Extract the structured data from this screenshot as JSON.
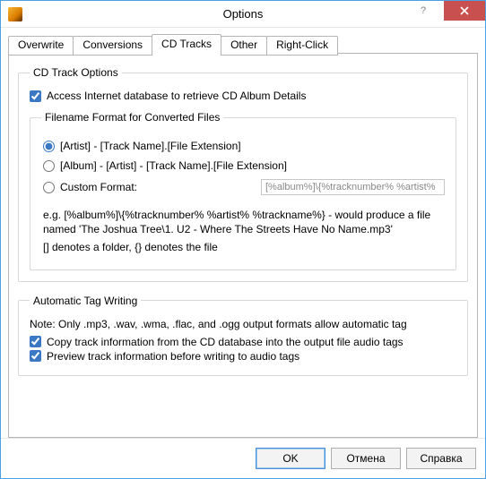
{
  "window": {
    "title": "Options"
  },
  "tabs": {
    "overwrite": "Overwrite",
    "conversions": "Conversions",
    "cdtracks": "CD Tracks",
    "other": "Other",
    "rightclick": "Right-Click"
  },
  "group_cdtrack": {
    "legend": "CD Track Options",
    "access_label": "Access Internet database to retrieve CD Album Details",
    "access_checked": true
  },
  "group_filename": {
    "legend": "Filename Format for Converted Files",
    "radio1_label": "[Artist] - [Track Name].[File Extension]",
    "radio2_label": "[Album] - [Artist] - [Track Name].[File Extension]",
    "radio3_label": "Custom Format:",
    "custom_value": "[%album%]\\{%tracknumber% %artist%",
    "eg_text": "e.g. [%album%]\\{%tracknumber% %artist% %trackname%} - would produce a file named 'The Joshua Tree\\1. U2 - Where The Streets Have No Name.mp3'",
    "eg_note": "[] denotes a folder, {} denotes the file"
  },
  "group_autotag": {
    "legend": "Automatic Tag Writing",
    "note": "Note: Only .mp3, .wav, .wma, .flac, and .ogg output formats allow automatic tag",
    "copy_label": "Copy track information from the CD database into the output file audio tags",
    "preview_label": "Preview track information before writing to audio tags"
  },
  "buttons": {
    "ok": "OK",
    "cancel": "Отмена",
    "help": "Справка"
  }
}
